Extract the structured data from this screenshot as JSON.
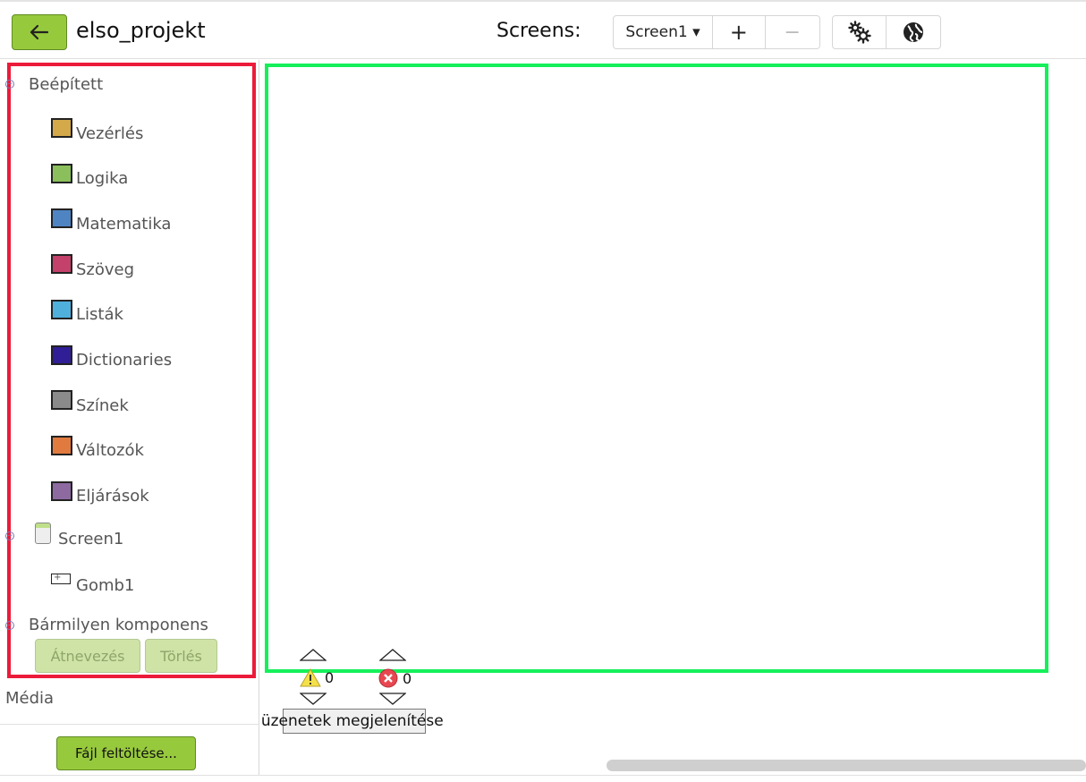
{
  "header": {
    "project_title": "elso_projekt",
    "screens_label": "Screens:",
    "screen_select": "Screen1 ▾",
    "add_screen": "+",
    "remove_screen": "−"
  },
  "blocks": {
    "builtin_label": "Beépített",
    "categories": [
      {
        "label": "Vezérlés",
        "color": "#d4a94a"
      },
      {
        "label": "Logika",
        "color": "#8bbf5b"
      },
      {
        "label": "Matematika",
        "color": "#4f84c2"
      },
      {
        "label": "Szöveg",
        "color": "#c4416b"
      },
      {
        "label": "Listák",
        "color": "#4fb0dc"
      },
      {
        "label": "Dictionaries",
        "color": "#2f1e95"
      },
      {
        "label": "Színek",
        "color": "#8a8a8a"
      },
      {
        "label": "Változók",
        "color": "#e07a3e"
      },
      {
        "label": "Eljárások",
        "color": "#8d6aa0"
      }
    ],
    "screen_label": "Screen1",
    "component_label": "Gomb1",
    "any_component_label": "Bármilyen komponens",
    "rename_button": "Átnevezés",
    "delete_button": "Törlés"
  },
  "media": {
    "label": "Média",
    "upload_button": "Fájl feltöltése..."
  },
  "workspace": {
    "warning_count": "0",
    "error_count": "0",
    "warnings_toggle": "Figyelmeztető üzenetek megjelenítése"
  },
  "colors": {
    "blocks_panel_border": "#ec1a3a",
    "workspace_border": "#15f05a",
    "accent_green": "#97c93d"
  }
}
